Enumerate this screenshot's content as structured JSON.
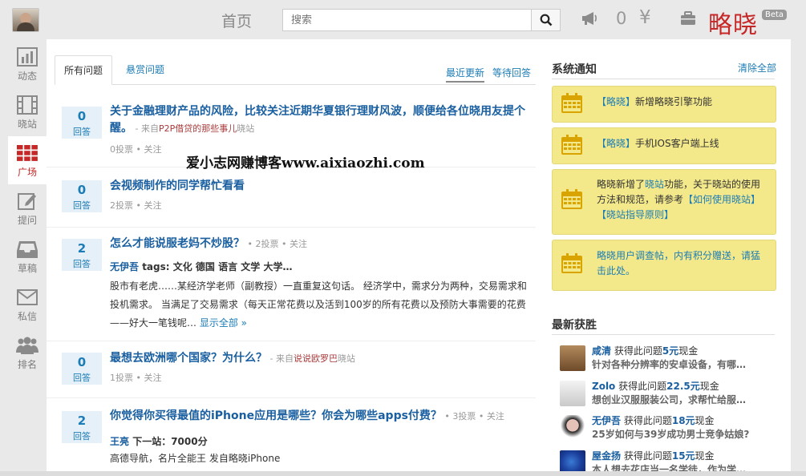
{
  "header": {
    "home_title": "首页",
    "search_placeholder": "搜索",
    "notify_count": "0",
    "currency_symbol": "¥",
    "brand": "略晓",
    "beta": "Beta"
  },
  "sidebar": {
    "items": [
      {
        "label": "动态",
        "icon": "bar-chart-icon"
      },
      {
        "label": "晓站",
        "icon": "film-icon"
      },
      {
        "label": "广场",
        "icon": "grid-icon",
        "active": true
      },
      {
        "label": "提问",
        "icon": "edit-icon"
      },
      {
        "label": "草稿",
        "icon": "inbox-icon"
      },
      {
        "label": "私信",
        "icon": "mail-icon"
      },
      {
        "label": "排名",
        "icon": "users-icon"
      }
    ]
  },
  "tabs": {
    "all": "所有问题",
    "bounty": "悬赏问题",
    "sort_recent": "最近更新",
    "sort_waiting": "等待回答"
  },
  "questions": [
    {
      "votes": "0",
      "votes_label": "回答",
      "title": "关于金融理财产品的风险，比较关注近期华夏银行理财风波，顺便给各位晓用友提个醒。",
      "meta_prefix": " - 来自",
      "source": "P2P借贷的那些事儿",
      "meta_suffix": "晓站",
      "stats": "0投票 • 关注"
    },
    {
      "votes": "0",
      "votes_label": "回答",
      "title": "会视频制作的同学帮忙看看",
      "stats": "2投票 • 关注"
    },
    {
      "votes": "2",
      "votes_label": "回答",
      "title": "怎么才能说服老妈不炒股？",
      "inline_stats": " • 2投票 • 关注",
      "answer_user": "无伊吾",
      "answer_tags": " tags: 文化 德国 语言 文学 大学…",
      "answer_body": "股市有老虎……某经济学老师（副教授）一直重复这句话。 经济学中，需求分为两种，交易需求和投机需求。 当满足了交易需求（每天正常花费以及活到100岁的所有花费以及预防大事需要的花费——好大一笔钱呢…",
      "show_all": " 显示全部 »"
    },
    {
      "votes": "0",
      "votes_label": "回答",
      "title": "最想去欧洲哪个国家？为什么？",
      "meta_prefix": " - 来自",
      "source": "说说欧罗巴",
      "meta_suffix": "晓站",
      "stats": "1投票 • 关注"
    },
    {
      "votes": "2",
      "votes_label": "回答",
      "title": "你觉得你买得最值的iPhone应用是哪些？你会为哪些apps付费？",
      "inline_stats": " • 3投票 • 关注",
      "answer_user": "王亮",
      "answer_tags": " 下一站：7000分",
      "answer_body": "高德导航，名片全能王 发自略晓iPhone"
    }
  ],
  "watermark": "爱小志网赚博客www.aixiaozhi.com",
  "notices": {
    "title": "系统通知",
    "clear": "清除全部",
    "items": [
      {
        "hl": "【略晓】",
        "text": "新增略晓引擎功能"
      },
      {
        "hl": "【略晓】",
        "text": "手机IOS客户端上线"
      },
      {
        "pre": "略晓新增了",
        "hl": "晓站",
        "text": "功能，关于晓站的使用方法和规范，请参考",
        "link1": "【如何使用晓站】",
        "link2": "【晓站指导原则】"
      },
      {
        "hl": "略晓用户调查帖，内有积分赠送，请猛击此处。"
      }
    ]
  },
  "winners": {
    "title": "最新获胜",
    "items": [
      {
        "user": "咸清",
        "mid": " 获得此问题",
        "amount": "5元",
        "suffix": "现金",
        "desc": "针对各种分辨率的安卓设备，有哪…"
      },
      {
        "user": "Zolo",
        "mid": " 获得此问题",
        "amount": "22.5元",
        "suffix": "现金",
        "desc": "想创业汉服服装公司，求帮忙给服…"
      },
      {
        "user": "无伊吾",
        "mid": " 获得此问题",
        "amount": "18元",
        "suffix": "现金",
        "desc": "25岁如何与39岁成功男士竞争姑娘?"
      },
      {
        "user": "屋金扬",
        "mid": " 获得此问题",
        "amount": "15元",
        "suffix": "现金",
        "desc": "本人想去花店当一名学徒，作为学…"
      }
    ]
  }
}
